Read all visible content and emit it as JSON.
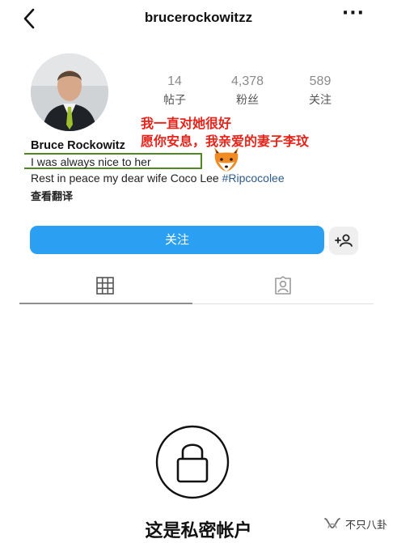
{
  "header": {
    "username": "brucerockowitzz",
    "more_label": "···"
  },
  "stats": [
    {
      "value": "14",
      "label": "帖子"
    },
    {
      "value": "4,378",
      "label": "粉丝"
    },
    {
      "value": "589",
      "label": "关注"
    }
  ],
  "annotation": {
    "line1": "我一直对她很好",
    "line2": "愿你安息，我亲爱的妻子李玟",
    "color": "#e8231a",
    "highlight_color": "#4d8b22",
    "emoji": "fox-face"
  },
  "profile": {
    "display_name": "Bruce Rockowitz",
    "bio_line1": "I was always nice to her",
    "bio_line2_text": "Rest in peace my dear wife Coco Lee ",
    "bio_hashtag": "#Ripcocolee",
    "translate_label": "查看翻译"
  },
  "actions": {
    "follow_label": "关注",
    "follow_color": "#2ba0f2",
    "add_friend_icon": "person-add-icon"
  },
  "tabs": {
    "grid_icon": "grid-icon",
    "tagged_icon": "tagged-person-icon"
  },
  "private": {
    "title": "这是私密帐户",
    "icon": "lock-icon"
  },
  "watermark": {
    "text": "不只八卦",
    "icon": "wechat-channel-icon"
  }
}
